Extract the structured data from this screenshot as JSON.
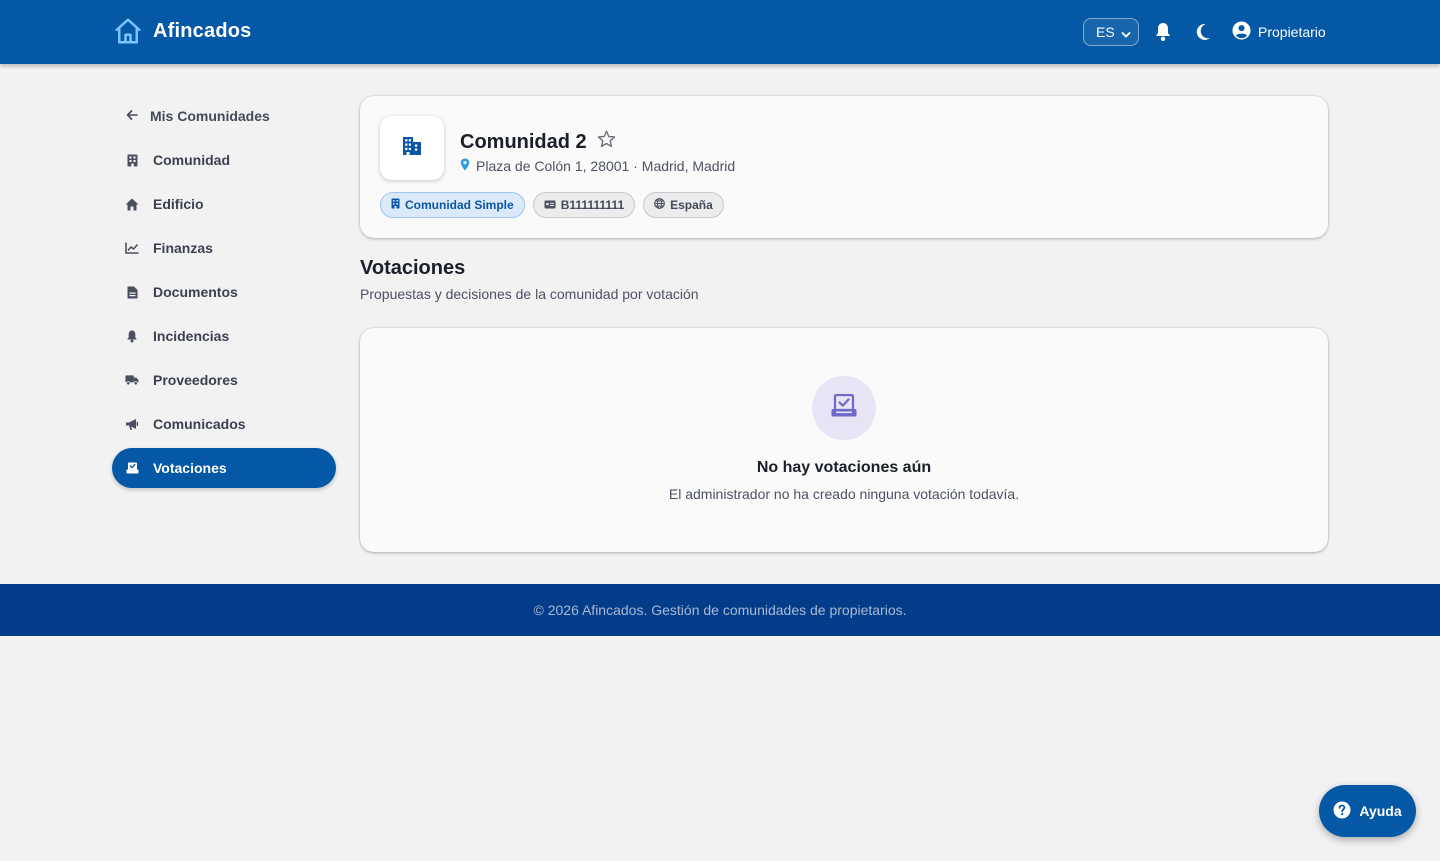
{
  "header": {
    "brand": "Afincados",
    "language": "ES",
    "user_label": "Propietario"
  },
  "sidebar": {
    "back_label": "Mis Comunidades",
    "items": [
      {
        "label": "Comunidad",
        "icon": "building-icon"
      },
      {
        "label": "Edificio",
        "icon": "home-icon"
      },
      {
        "label": "Finanzas",
        "icon": "chart-line-icon"
      },
      {
        "label": "Documentos",
        "icon": "document-icon"
      },
      {
        "label": "Incidencias",
        "icon": "bell-icon"
      },
      {
        "label": "Proveedores",
        "icon": "truck-icon"
      },
      {
        "label": "Comunicados",
        "icon": "megaphone-icon"
      },
      {
        "label": "Votaciones",
        "icon": "ballot-icon",
        "active": true
      }
    ]
  },
  "community": {
    "name": "Comunidad 2",
    "address": "Plaza de Colón 1, 28001 · Madrid, Madrid",
    "chips": {
      "type": "Comunidad Simple",
      "tax_id": "B111111111",
      "country": "España"
    }
  },
  "section": {
    "title": "Votaciones",
    "subtitle": "Propuestas y decisiones de la comunidad por votación"
  },
  "empty_state": {
    "title": "No hay votaciones aún",
    "text": "El administrador no ha creado ninguna votación todavía."
  },
  "footer": {
    "text": "© 2026 Afincados. Gestión de comunidades de propietarios."
  },
  "help_button": {
    "label": "Ayuda"
  },
  "colors": {
    "primary": "#0458a6",
    "footer": "#033d8a",
    "background": "#f2f2f3",
    "chip_primary_bg": "#dbeafb"
  }
}
